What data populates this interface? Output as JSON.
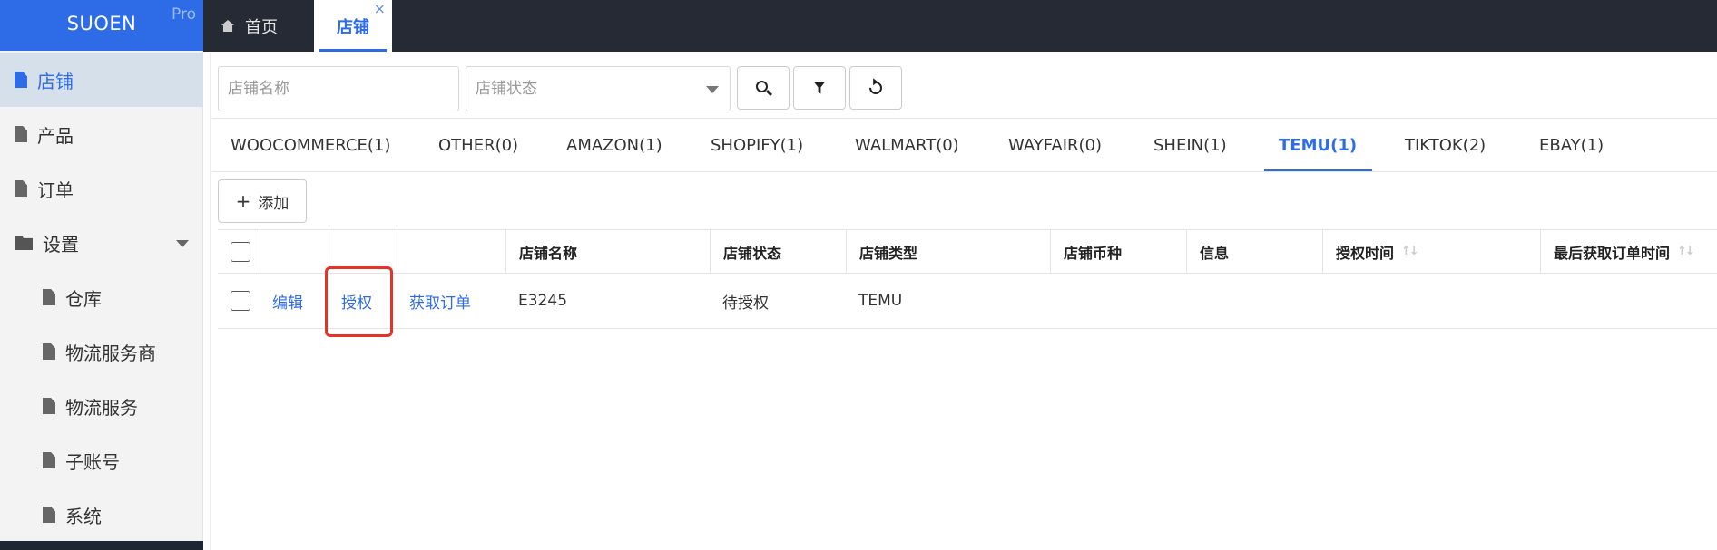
{
  "sidebar": {
    "brand": "SUOEN",
    "badge": "Pro",
    "items": [
      {
        "label": "店铺"
      },
      {
        "label": "产品"
      },
      {
        "label": "订单"
      },
      {
        "label": "设置"
      },
      {
        "label": "仓库"
      },
      {
        "label": "物流服务商"
      },
      {
        "label": "物流服务"
      },
      {
        "label": "子账号"
      },
      {
        "label": "系统"
      }
    ]
  },
  "tabs": {
    "home": "首页",
    "current": "店铺",
    "close_glyph": "×"
  },
  "filters": {
    "name_placeholder": "店铺名称",
    "status_placeholder": "店铺状态"
  },
  "platform_tabs": [
    "WOOCOMMERCE(1)",
    "OTHER(0)",
    "AMAZON(1)",
    "SHOPIFY(1)",
    "WALMART(0)",
    "WAYFAIR(0)",
    "SHEIN(1)",
    "TEMU(1)",
    "TIKTOK(2)",
    "EBAY(1)"
  ],
  "active_platform": "TEMU(1)",
  "add_button": {
    "icon": "+",
    "label": "添加"
  },
  "table": {
    "columns": [
      "店铺名称",
      "店铺状态",
      "店铺类型",
      "店铺币种",
      "信息",
      "授权时间",
      "最后获取订单时间"
    ],
    "sort_glyph": "↑↓",
    "rows": [
      {
        "actions": [
          "编辑",
          "授权",
          "获取订单"
        ],
        "name": "E3245",
        "status": "待授权",
        "type": "TEMU",
        "currency": "",
        "info": "",
        "auth_time": "",
        "last_fetch_time": ""
      }
    ]
  },
  "colors": {
    "brand": "#2e6be6",
    "topbar": "#252a35",
    "highlight": "#e5332a"
  }
}
